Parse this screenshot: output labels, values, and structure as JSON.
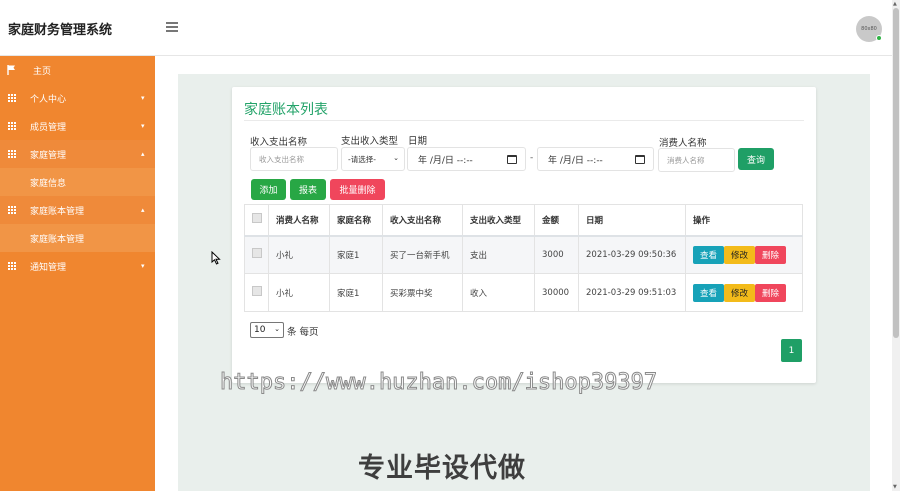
{
  "header": {
    "brand": "家庭财务管理系统",
    "avatar_text": "80x80"
  },
  "sidebar": {
    "items": [
      {
        "label": "主页",
        "icon": "flag-icon"
      },
      {
        "label": "个人中心",
        "icon": "grid-icon",
        "caret": "▾"
      },
      {
        "label": "成员管理",
        "icon": "grid-icon",
        "caret": "▾"
      },
      {
        "label": "家庭管理",
        "icon": "grid-icon",
        "caret": "▴"
      },
      {
        "label": "家庭信息"
      },
      {
        "label": "家庭账本管理",
        "icon": "grid-icon",
        "caret": "▴"
      },
      {
        "label": "家庭账本管理"
      },
      {
        "label": "通知管理",
        "icon": "grid-icon",
        "caret": "▾"
      }
    ]
  },
  "panel": {
    "title": "家庭账本列表"
  },
  "filters": {
    "name_label": "收入支出名称",
    "name_placeholder": "收入支出名称",
    "type_label": "支出收入类型",
    "type_value": "-请选择-",
    "date_label": "日期",
    "date_from": "年 /月/日 --:--",
    "date_sep": "-",
    "date_to": "年 /月/日 --:--",
    "person_label": "消费人名称",
    "person_placeholder": "消费人名称",
    "query_btn": "查询"
  },
  "actions": {
    "add": "添加",
    "report": "报表",
    "batch_delete": "批量删除"
  },
  "table": {
    "headers": [
      "消费人名称",
      "家庭名称",
      "收入支出名称",
      "支出收入类型",
      "金额",
      "日期",
      "操作"
    ],
    "rows": [
      {
        "person": "小礼",
        "family": "家庭1",
        "name": "买了一台新手机",
        "type": "支出",
        "amount": "3000",
        "date": "2021-03-29 09:50:36"
      },
      {
        "person": "小礼",
        "family": "家庭1",
        "name": "买彩票中奖",
        "type": "收入",
        "amount": "30000",
        "date": "2021-03-29 09:51:03"
      }
    ],
    "op_view": "查看",
    "op_edit": "修改",
    "op_delete": "删除"
  },
  "pager": {
    "page_size": "10",
    "per_page_text": "条 每页",
    "current_page": "1"
  },
  "overlay": {
    "watermark": "https://www.huzhan.com/ishop39397",
    "slogan": "专业毕设代做"
  },
  "colors": {
    "sidebar": "#f0862f",
    "accent_green": "#1f9f66",
    "danger": "#f0465c",
    "info": "#17a2b8",
    "warning": "#f3bb1a"
  }
}
